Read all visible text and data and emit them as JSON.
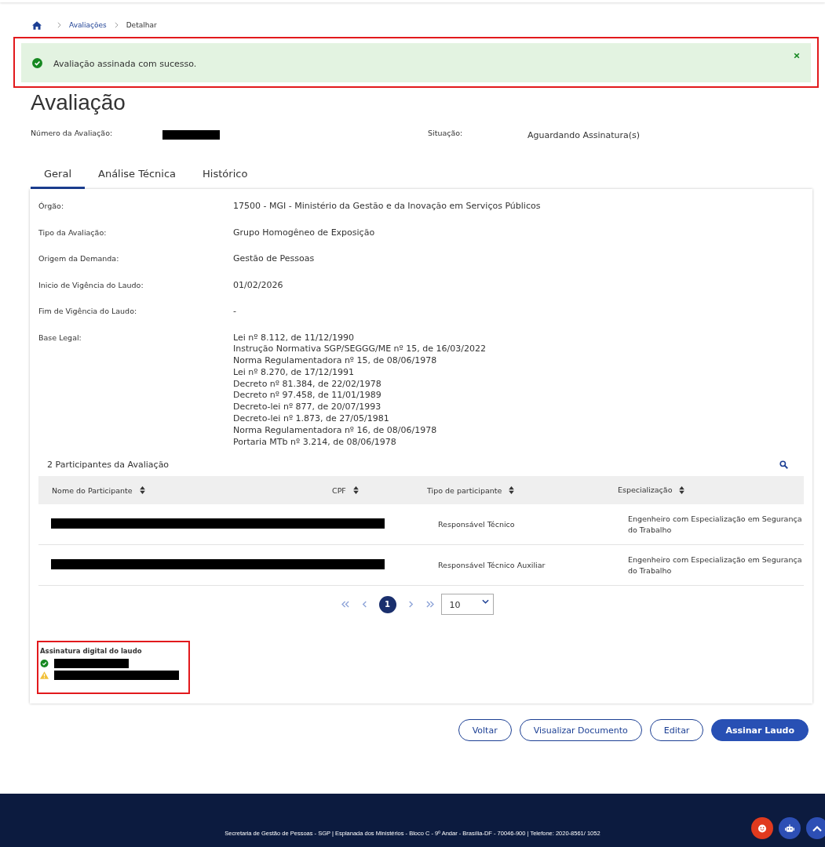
{
  "breadcrumb": [
    {
      "label": "Avaliações",
      "kind": "link"
    },
    {
      "label": "Detalhar",
      "kind": "current"
    }
  ],
  "alert": {
    "kind": "success",
    "message": "Avaliação assinada com sucesso."
  },
  "title": "Avaliação",
  "header_fields": [
    {
      "label": "Número da Avaliação:"
    },
    {
      "label": "Situação:",
      "value": "Aguardando Assinatura(s)"
    }
  ],
  "tabs": [
    {
      "label": "Geral",
      "selected": true
    },
    {
      "label": "Análise Técnica",
      "selected": false
    },
    {
      "label": "Histórico",
      "selected": false
    }
  ],
  "fields": [
    {
      "label": "Órgão:",
      "values": [
        "17500 - MGI - Ministério da Gestão e da Inovação em Serviços Públicos"
      ]
    },
    {
      "label": "Tipo da Avaliação:",
      "values": [
        "Grupo Homogêneo de Exposição"
      ]
    },
    {
      "label": "Origem da Demanda:",
      "values": [
        "Gestão de Pessoas"
      ]
    },
    {
      "label": "Inicio de Vigência do Laudo:",
      "values": [
        "01/02/2026"
      ]
    },
    {
      "label": "Fim de Vigência do Laudo:",
      "values": [
        "-"
      ]
    },
    {
      "label": "Base Legal:",
      "values": [
        "Lei nº 8.112, de 11/12/1990",
        "Instrução Normativa SGP/SEGGG/ME nº 15, de 16/03/2022",
        "Norma Regulamentadora nº 15, de 08/06/1978",
        "Lei nº 8.270, de 17/12/1991",
        "Decreto nº 81.384, de 22/02/1978",
        "Decreto nº 97.458, de 11/01/1989",
        "Decreto-lei nº 877, de 20/07/1993",
        "Decreto-lei nº 1.873, de 27/05/1981",
        "Norma Regulamentadora nº 16, de 08/06/1978",
        "Portaria MTb nº 3.214, de 08/06/1978"
      ]
    }
  ],
  "participants": {
    "title": "2 Participantes da Avaliação",
    "columns": [
      "Nome do Participante",
      "CPF",
      "Tipo de participante",
      "Especialização"
    ],
    "rows": [
      {
        "tipo": "Responsável Técnico",
        "especializacao": "Engenheiro com Especialização em Segurança do Trabalho"
      },
      {
        "tipo": "Responsável Técnico Auxiliar",
        "especializacao": "Engenheiro com Especialização em Segurança do Trabalho"
      }
    ]
  },
  "pagination": {
    "pages": [
      {
        "label": "1",
        "selected": true
      }
    ],
    "page_size": "10"
  },
  "signature": {
    "title": "Assinatura digital do laudo",
    "signers": [
      {
        "kind": "signed"
      },
      {
        "kind": "pending"
      }
    ]
  },
  "buttons": [
    {
      "label": "Voltar",
      "kind": "outline"
    },
    {
      "label": "Visualizar Documento",
      "kind": "outline"
    },
    {
      "label": "Editar",
      "kind": "outline"
    },
    {
      "label": "Assinar Laudo",
      "kind": "primary"
    }
  ],
  "footer": "Secretaria de Gestão de Pessoas - SGP | Esplanada dos Ministérios - Bloco C - 9º Andar - Brasília-DF - 70046-900 | Telefone: 2020-8561/ 1052"
}
